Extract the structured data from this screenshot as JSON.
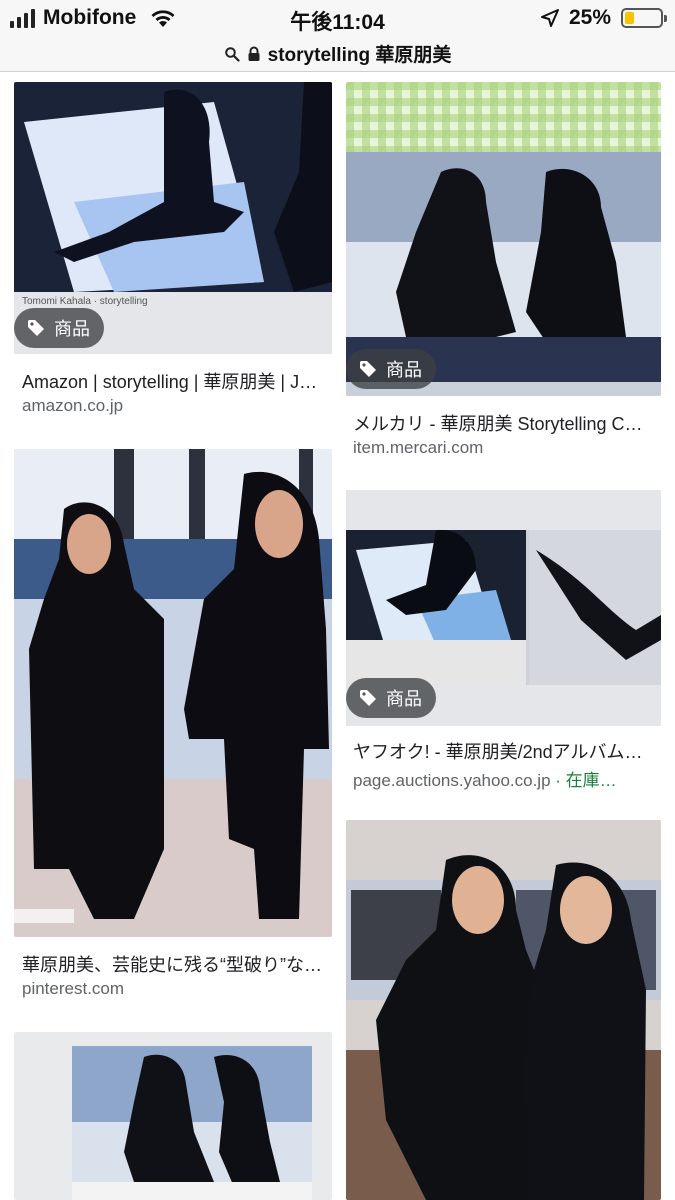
{
  "status_bar": {
    "carrier": "Mobifone",
    "time": "午後11:04",
    "battery_percent": "25%",
    "battery_level": 0.25,
    "battery_color": "#f5c400"
  },
  "url_bar": {
    "query": "storytelling 華原朋美",
    "icons": [
      "search-icon",
      "lock-icon"
    ]
  },
  "results": [
    {
      "badge": "商品",
      "title": "Amazon | storytelling | 華原朋美 | J…",
      "domain": "amazon.co.jp"
    },
    {
      "badge": "商品",
      "title": "メルカリ - 華原朋美 Storytelling C…",
      "domain": "item.mercari.com"
    },
    {
      "title": "華原朋美、芸能史に残る“型破り”な…",
      "domain": "pinterest.com"
    },
    {
      "badge": "商品",
      "title": "ヤフオク! - 華原朋美/2ndアルバム…",
      "domain": "page.auctions.yahoo.co.jp",
      "extra": " · 在庫…"
    },
    {
      "title": "",
      "domain": ""
    },
    {
      "title": "",
      "domain": ""
    }
  ],
  "colors": {
    "stock_green": "#188038",
    "badge_bg": "rgba(60,64,67,0.78)"
  }
}
